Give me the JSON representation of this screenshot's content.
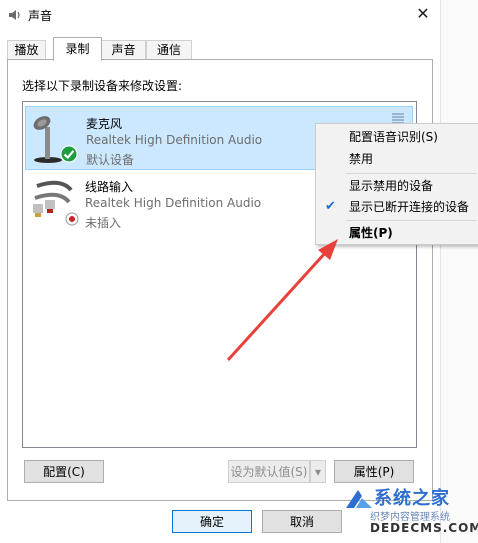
{
  "window": {
    "title": "声音",
    "close_glyph": "✕"
  },
  "tabs": [
    {
      "label": "播放"
    },
    {
      "label": "录制",
      "active": true
    },
    {
      "label": "声音"
    },
    {
      "label": "通信"
    }
  ],
  "prompt": "选择以下录制设备来修改设置:",
  "devices": [
    {
      "name": "麦克风",
      "driver": "Realtek High Definition Audio",
      "status": "默认设备",
      "icon": "microphone-icon",
      "badge": "default-check-icon",
      "selected": true
    },
    {
      "name": "线路输入",
      "driver": "Realtek High Definition Audio",
      "status": "未插入",
      "icon": "line-in-cable-icon",
      "badge": "unplugged-icon",
      "selected": false
    }
  ],
  "context_menu": {
    "items": [
      {
        "label": "配置语音识别(S)"
      },
      {
        "label": "禁用"
      },
      {
        "label": "显示禁用的设备"
      },
      {
        "label": "显示已断开连接的设备",
        "checked": true
      },
      {
        "label": "属性(P)",
        "bold": true
      }
    ]
  },
  "buttons": {
    "configure": "配置(C)",
    "set_default": "设为默认值(S)",
    "properties": "属性(P)",
    "ok": "确定",
    "cancel": "取消"
  },
  "watermark": {
    "line1": "系统之家",
    "line2": "织梦内容管理系统",
    "line3": "DEDECMS.COM"
  },
  "colors": {
    "selection": "#cce8ff",
    "annotation_arrow": "#e8413a",
    "check": "#1e6fd2"
  }
}
